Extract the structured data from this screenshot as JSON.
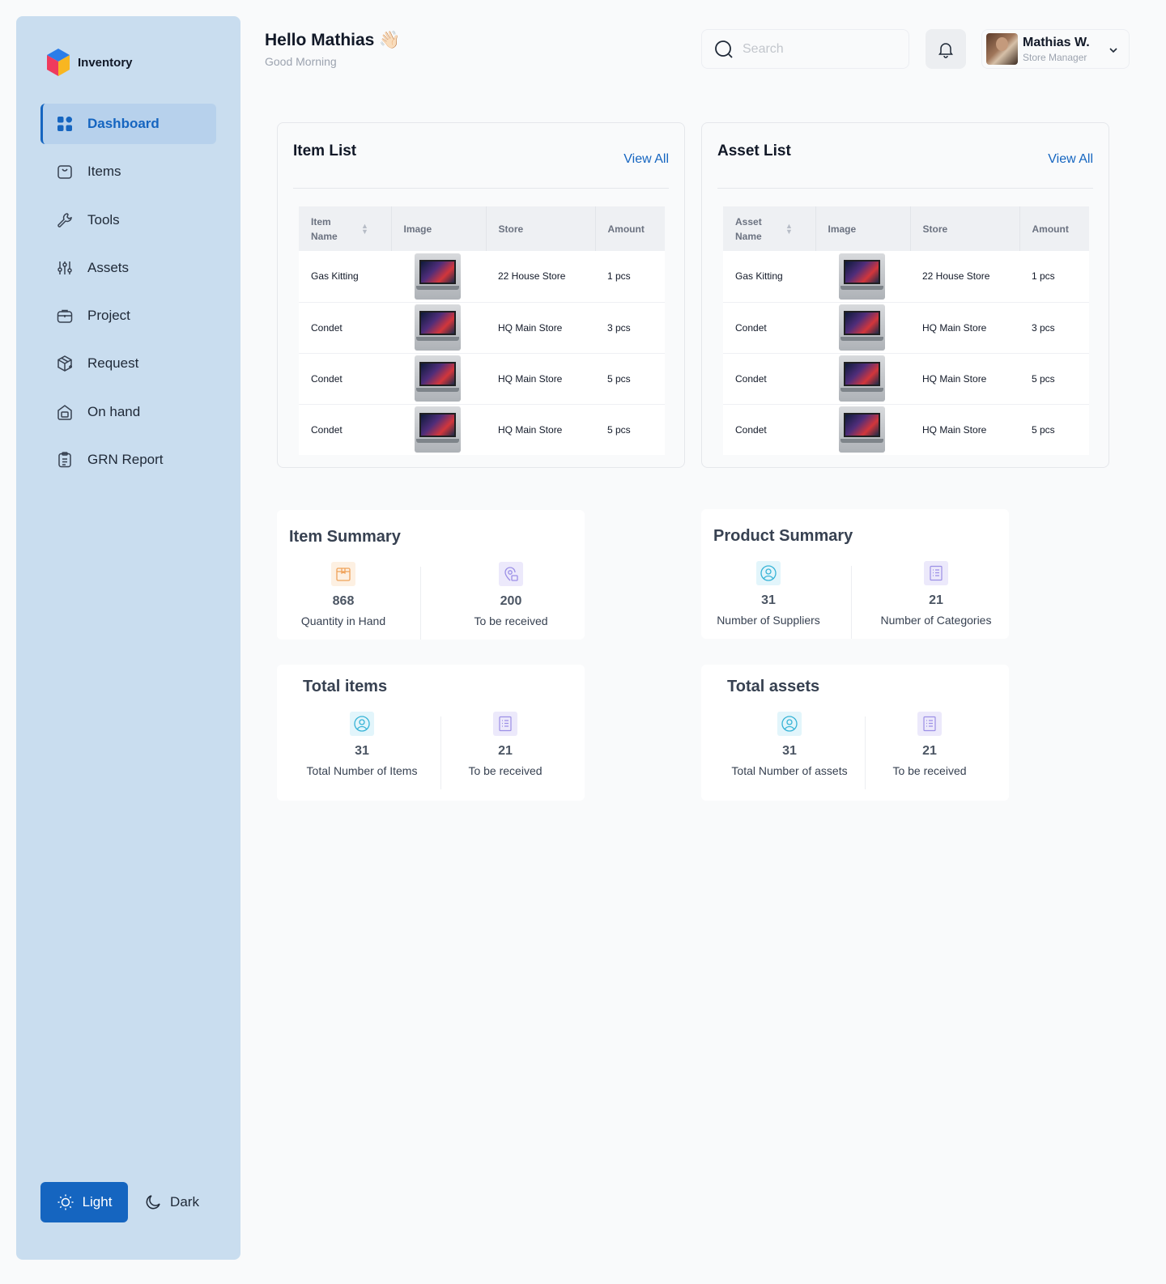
{
  "brand": {
    "name": "Inventory",
    "logo_icon": "cube-logo"
  },
  "nav": [
    {
      "label": "Dashboard",
      "icon": "grid-icon",
      "active": true
    },
    {
      "label": "Items",
      "icon": "bag-icon"
    },
    {
      "label": "Tools",
      "icon": "wrench-icon"
    },
    {
      "label": "Assets",
      "icon": "sliders-icon"
    },
    {
      "label": "Project",
      "icon": "briefcase-icon"
    },
    {
      "label": "Request",
      "icon": "box-plus-icon"
    },
    {
      "label": "On hand",
      "icon": "home-box-icon"
    },
    {
      "label": "GRN Report",
      "icon": "clipboard-icon"
    }
  ],
  "theme": {
    "light_label": "Light",
    "dark_label": "Dark",
    "selected": "Light"
  },
  "header": {
    "greeting": "Hello Mathias",
    "greeting_emoji": "👋🏻",
    "subtitle": "Good Morning",
    "search_placeholder": "Search",
    "user_name": "Mathias W.",
    "user_role": "Store Manager"
  },
  "item_list": {
    "title": "Item List",
    "view_all": "View All",
    "columns": [
      "Item Name",
      "Image",
      "Store",
      "Amount"
    ],
    "rows": [
      {
        "name": "Gas Kitting",
        "store": "22 House Store",
        "amount": "1 pcs"
      },
      {
        "name": "Condet",
        "store": "HQ Main Store",
        "amount": "3 pcs"
      },
      {
        "name": "Condet",
        "store": "HQ Main Store",
        "amount": "5 pcs"
      },
      {
        "name": "Condet",
        "store": "HQ Main Store",
        "amount": "5 pcs"
      }
    ]
  },
  "asset_list": {
    "title": "Asset List",
    "view_all": "View All",
    "columns": [
      "Asset Name",
      "Image",
      "Store",
      "Amount"
    ],
    "rows": [
      {
        "name": "Gas Kitting",
        "store": "22 House Store",
        "amount": "1 pcs"
      },
      {
        "name": "Condet",
        "store": "HQ Main Store",
        "amount": "3 pcs"
      },
      {
        "name": "Condet",
        "store": "HQ Main Store",
        "amount": "5 pcs"
      },
      {
        "name": "Condet",
        "store": "HQ Main Store",
        "amount": "5 pcs"
      }
    ]
  },
  "item_summary": {
    "title": "Item Summary",
    "stats": [
      {
        "value": "868",
        "label": "Quantity in Hand",
        "icon": "box-icon"
      },
      {
        "value": "200",
        "label": "To be received",
        "icon": "location-icon"
      }
    ]
  },
  "product_summary": {
    "title": "Product Summary",
    "stats": [
      {
        "value": "31",
        "label": "Number of Suppliers",
        "icon": "user-icon"
      },
      {
        "value": "21",
        "label": "Number of Categories",
        "icon": "list-icon"
      }
    ]
  },
  "total_items": {
    "title": "Total items",
    "stats": [
      {
        "value": "31",
        "label": "Total Number of Items",
        "icon": "user-icon"
      },
      {
        "value": "21",
        "label": "To be received",
        "icon": "list-icon"
      }
    ]
  },
  "total_assets": {
    "title": "Total assets",
    "stats": [
      {
        "value": "31",
        "label": "Total Number of assets",
        "icon": "user-icon"
      },
      {
        "value": "21",
        "label": "To be received",
        "icon": "list-icon"
      }
    ]
  },
  "colors": {
    "accent": "#1565c0",
    "sidebar_bg": "#c9ddef",
    "page_bg": "#f9fafb"
  }
}
